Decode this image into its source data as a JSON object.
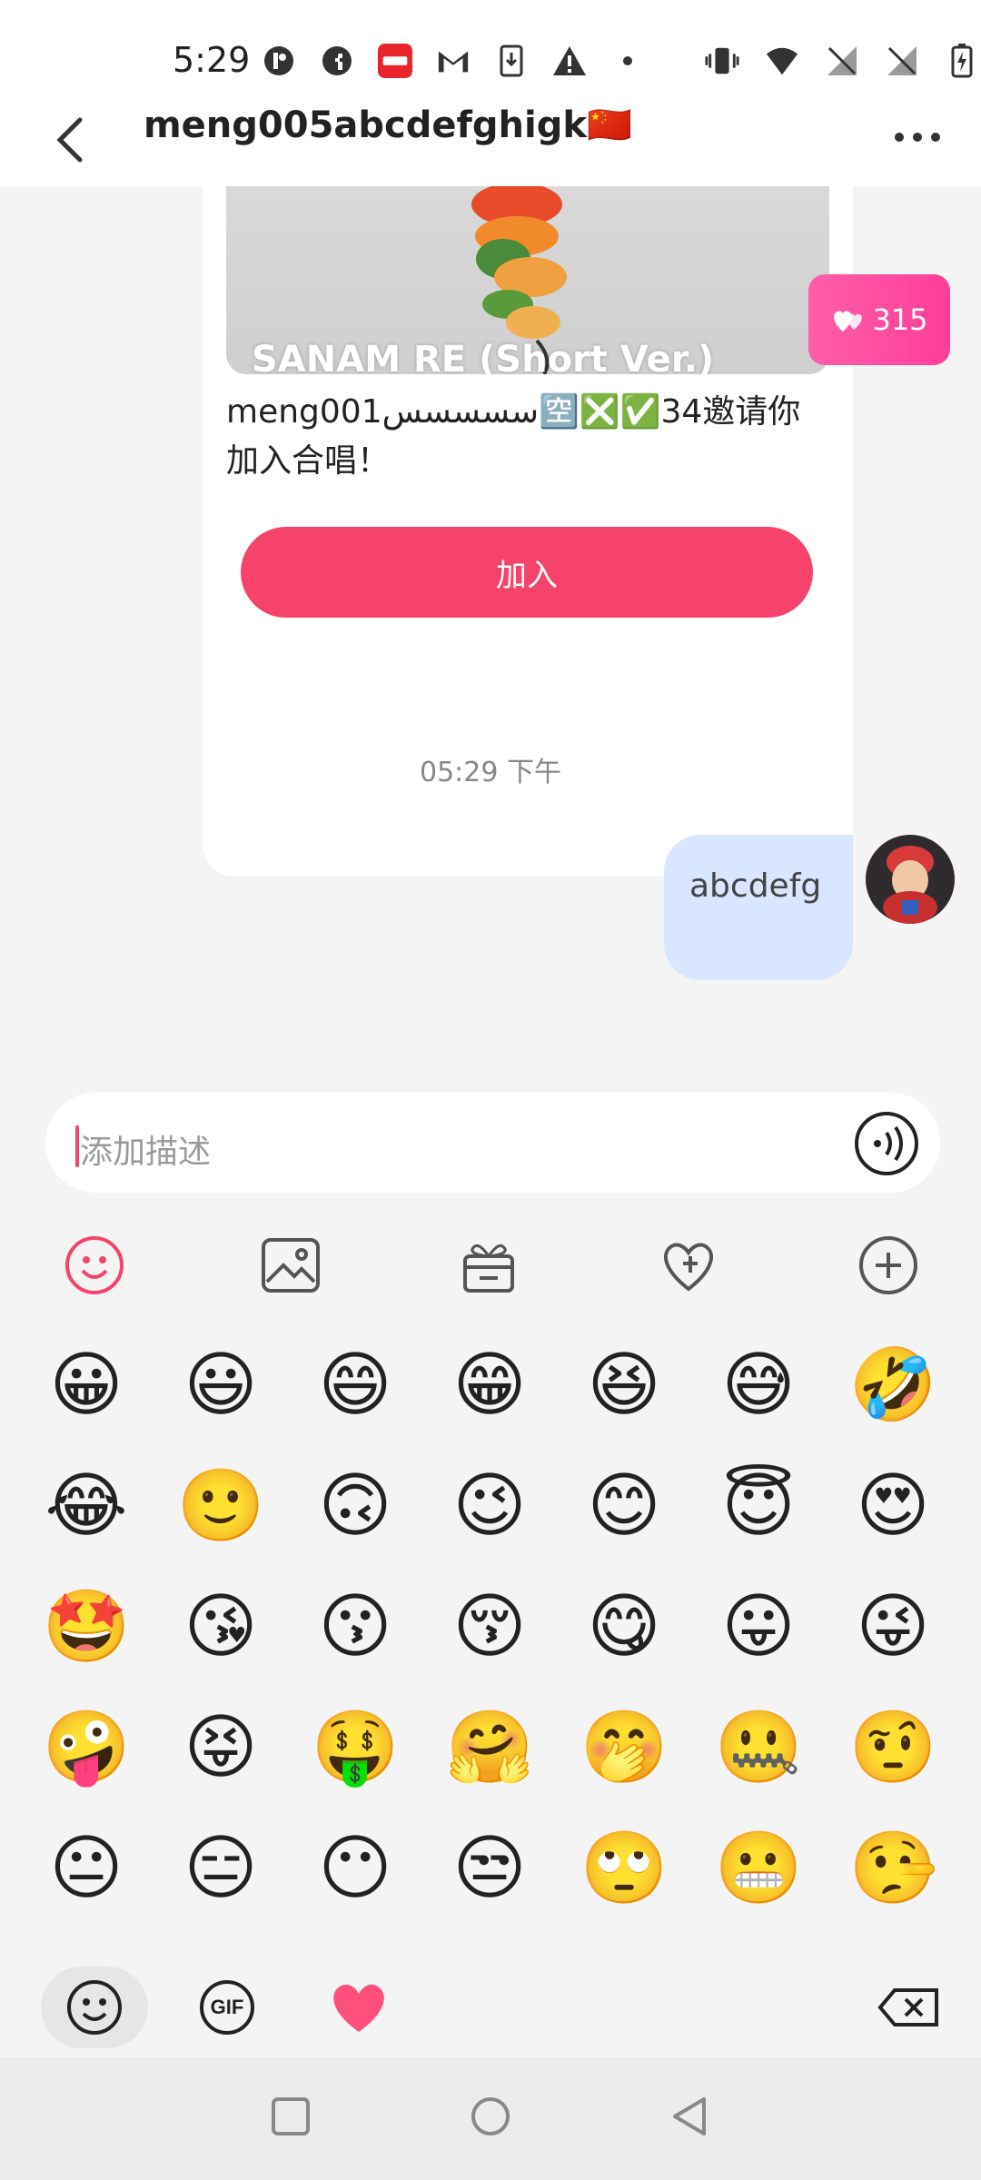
{
  "status_bar": {
    "time": "5:29",
    "left_icons": [
      "profile-app-icon",
      "facebook-icon",
      "xiaohongshu-icon",
      "gmail-icon",
      "download-icon",
      "warning-icon",
      "dot-icon"
    ],
    "right_icons": [
      "vibrate-icon",
      "wifi-icon",
      "no-signal-icon",
      "no-signal-icon",
      "battery-charging-icon"
    ]
  },
  "header": {
    "title": "meng005abcdefghigk🇨🇳"
  },
  "card": {
    "song_title": "SANAM RE (Short Ver.)",
    "invite_text": "meng001سسسسس🈳❎✅34邀请你加入合唱！",
    "join_label": "加入",
    "likes": "315"
  },
  "chat": {
    "timestamp": "05:29 下午",
    "message": "abcdefg"
  },
  "input": {
    "placeholder": "添加描述"
  },
  "emojis": [
    "😀",
    "😃",
    "😄",
    "😁",
    "😆",
    "😅",
    "🤣",
    "😂",
    "🙂",
    "🙃",
    "😉",
    "😊",
    "😇",
    "😍",
    "🤩",
    "😘",
    "😗",
    "😚",
    "😋",
    "😛",
    "😜",
    "🤪",
    "😝",
    "🤑",
    "🤗",
    "🤭",
    "🤐",
    "🤨",
    "😐",
    "😑",
    "😶",
    "😒",
    "🙄",
    "😬",
    "🤥"
  ],
  "emoji_bar": {
    "gif_label": "GIF"
  },
  "colors": {
    "accent": "#f6436b",
    "bubble": "#d9e6ff",
    "badge": "#ff4fa3"
  }
}
